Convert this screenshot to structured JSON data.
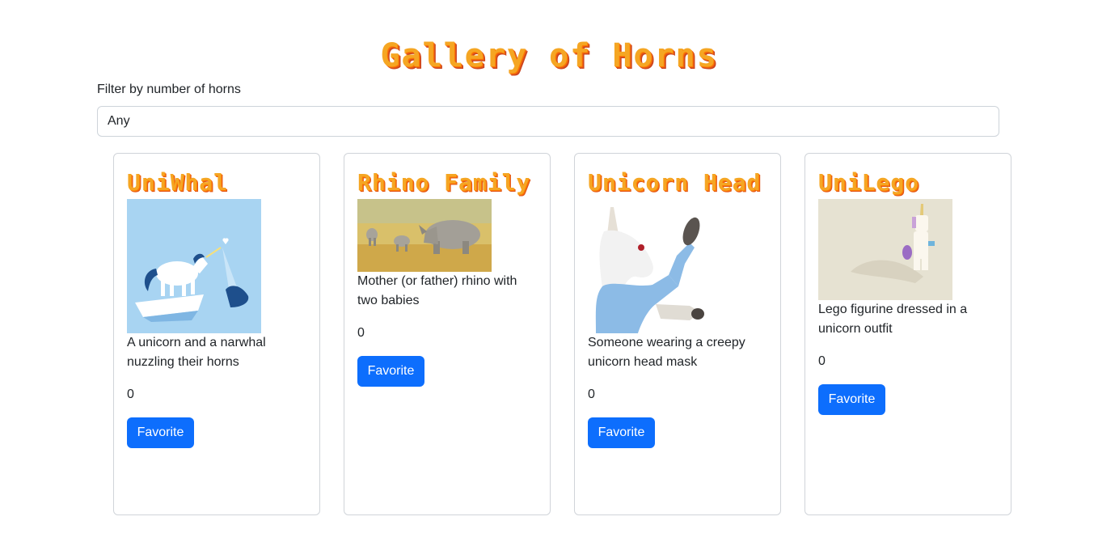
{
  "header": {
    "title": "Gallery of Horns"
  },
  "filter": {
    "label": "Filter by number of horns",
    "selected": "Any"
  },
  "cards": [
    {
      "title": "UniWhal",
      "description": "A unicorn and a narwhal nuzzling their horns",
      "count": "0",
      "button": "Favorite",
      "image": "unicorn-narwhal-image"
    },
    {
      "title": "Rhino Family",
      "description": "Mother (or father) rhino with two babies",
      "count": "0",
      "button": "Favorite",
      "image": "rhino-family-image"
    },
    {
      "title": "Unicorn Head",
      "description": "Someone wearing a creepy unicorn head mask",
      "count": "0",
      "button": "Favorite",
      "image": "unicorn-mask-image"
    },
    {
      "title": "UniLego",
      "description": "Lego figurine dressed in a unicorn outfit",
      "count": "0",
      "button": "Favorite",
      "image": "lego-unicorn-image"
    }
  ],
  "colors": {
    "accent": "#0d6efd",
    "title": "#f5a623"
  }
}
